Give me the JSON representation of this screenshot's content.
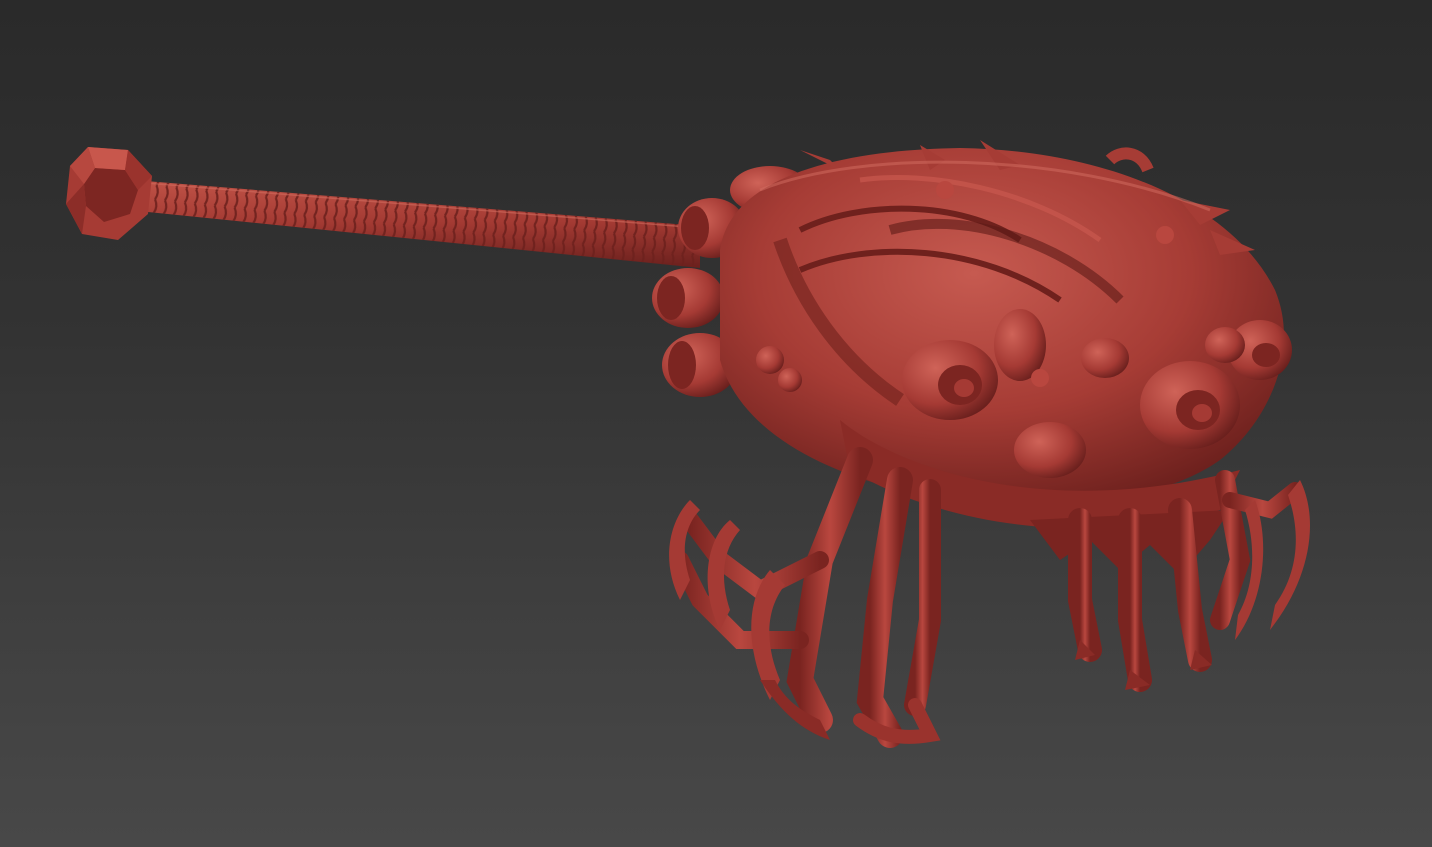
{
  "viewport": {
    "model_color": "#a53a34",
    "highlight_color": "#c5554b",
    "shadow_color": "#5e1a18",
    "background_top": "#2a2a2a",
    "background_bottom": "#484848"
  },
  "model": {
    "subject": "biomechanical-crab-cannon"
  }
}
